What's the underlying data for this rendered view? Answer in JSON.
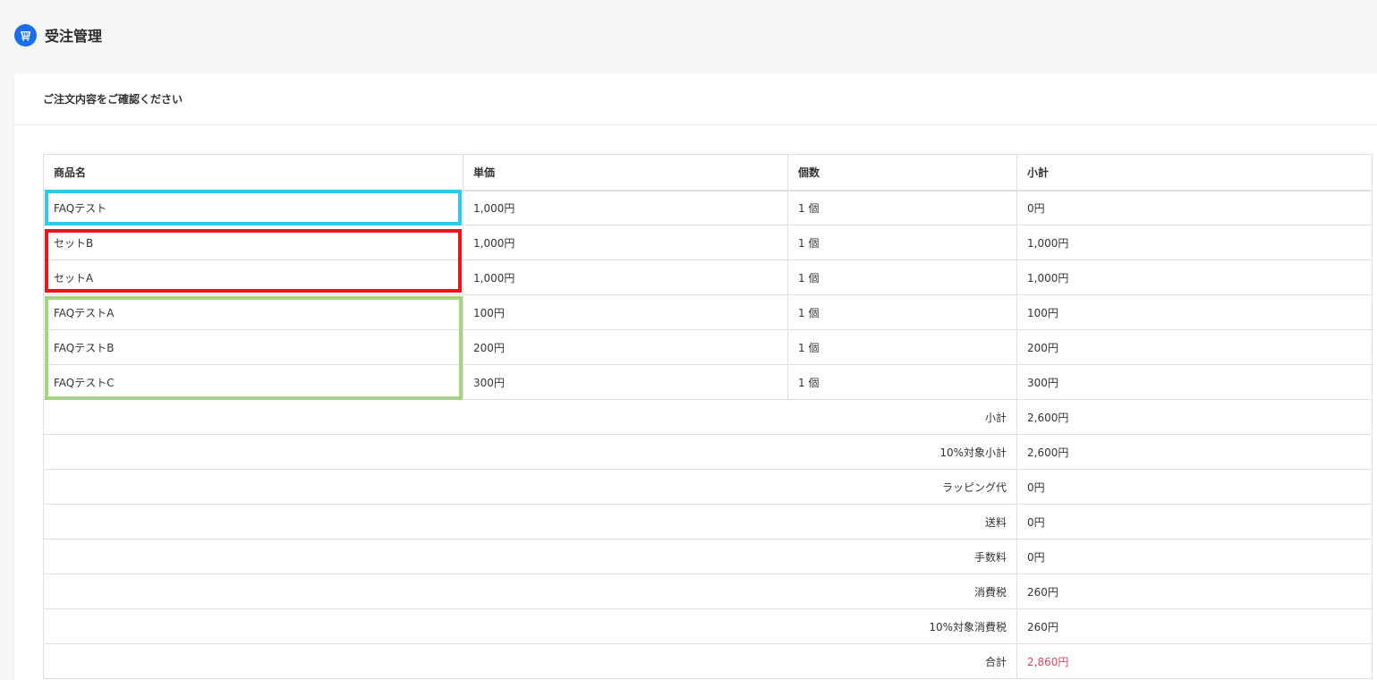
{
  "header": {
    "title": "受注管理",
    "icon": "cart-icon",
    "icon_color": "#1a6ee8"
  },
  "card": {
    "heading": "ご注文内容をご確認ください"
  },
  "table": {
    "columns": [
      "商品名",
      "単価",
      "個数",
      "小計"
    ],
    "rows": [
      {
        "name": "FAQテスト",
        "price": "1,000円",
        "qty": "1 個",
        "subtotal": "0円"
      },
      {
        "name": "セットB",
        "price": "1,000円",
        "qty": "1 個",
        "subtotal": "1,000円"
      },
      {
        "name": "セットA",
        "price": "1,000円",
        "qty": "1 個",
        "subtotal": "1,000円"
      },
      {
        "name": "FAQテストA",
        "price": "100円",
        "qty": "1 個",
        "subtotal": "100円"
      },
      {
        "name": "FAQテストB",
        "price": "200円",
        "qty": "1 個",
        "subtotal": "200円"
      },
      {
        "name": "FAQテストC",
        "price": "300円",
        "qty": "1 個",
        "subtotal": "300円"
      }
    ],
    "summary": [
      {
        "label": "小計",
        "value": "2,600円"
      },
      {
        "label": "10%対象小計",
        "value": "2,600円"
      },
      {
        "label": "ラッピング代",
        "value": "0円"
      },
      {
        "label": "送料",
        "value": "0円"
      },
      {
        "label": "手数料",
        "value": "0円"
      },
      {
        "label": "消費税",
        "value": "260円"
      },
      {
        "label": "10%対象消費税",
        "value": "260円"
      },
      {
        "label": "合計",
        "value": "2,860円"
      }
    ],
    "total_color": "#d9485a"
  },
  "highlights": [
    {
      "color": "#33c8e8"
    },
    {
      "color": "#e8151b"
    },
    {
      "color": "#a6d37f"
    }
  ]
}
